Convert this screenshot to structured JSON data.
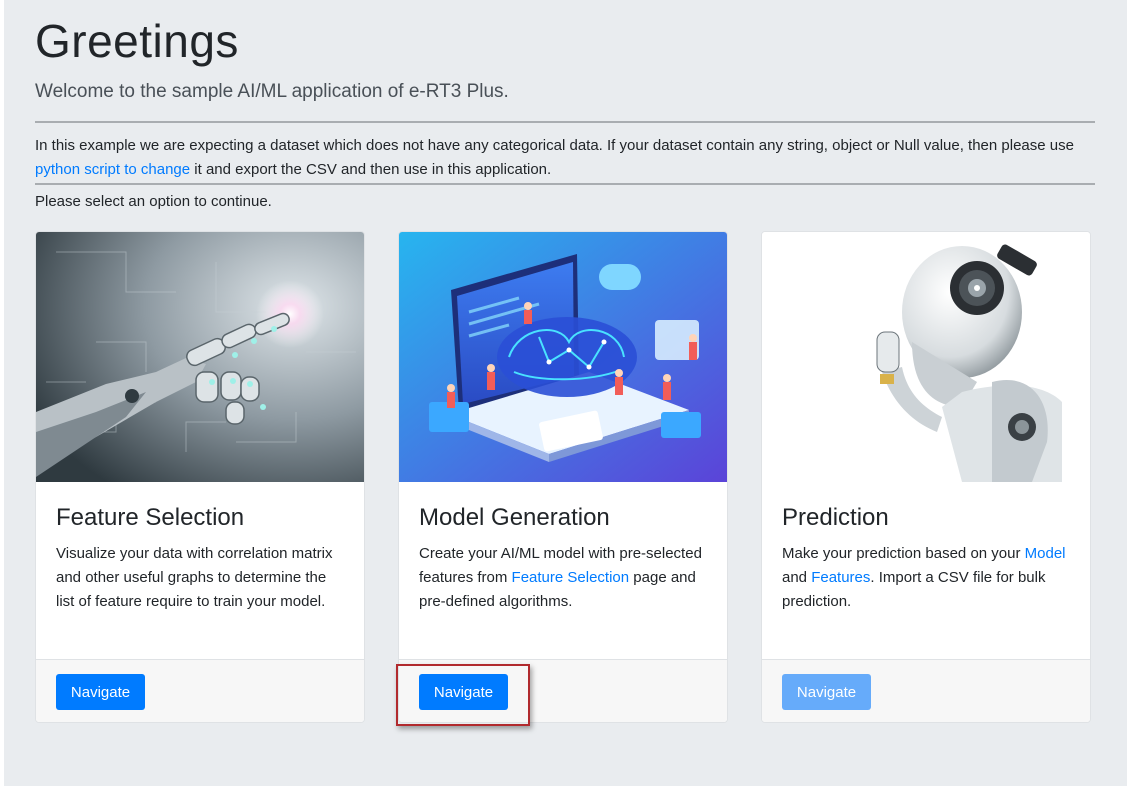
{
  "header": {
    "title": "Greetings",
    "subtitle": "Welcome to the sample AI/ML application of e-RT3 Plus."
  },
  "intro": {
    "text_before_link": "In this example we are expecting a dataset which does not have any categorical data. If your dataset contain any string, object or Null value, then please use ",
    "link_text": "python script to change",
    "text_after_link": " it and export the CSV and then use in this application.",
    "prompt": "Please select an option to continue."
  },
  "cards": [
    {
      "title": "Feature Selection",
      "text": "Visualize your data with correlation matrix and other useful graphs to determine the list of feature require to train your model.",
      "button": "Navigate"
    },
    {
      "title": "Model Generation",
      "text_1": "Create your AI/ML model with pre-selected features from ",
      "link_1": "Feature Selection",
      "text_2": " page and pre-defined algorithms.",
      "button": "Navigate"
    },
    {
      "title": "Prediction",
      "text_1": "Make your prediction based on your ",
      "link_1": "Model",
      "text_2": " and ",
      "link_2": "Features",
      "text_3": ". Import a CSV file for bulk prediction.",
      "button": "Navigate"
    }
  ],
  "colors": {
    "page_bg": "#e9ecef",
    "primary": "#007bff",
    "primary_disabled": "#66abfa",
    "highlight_box": "#b12a2e"
  }
}
